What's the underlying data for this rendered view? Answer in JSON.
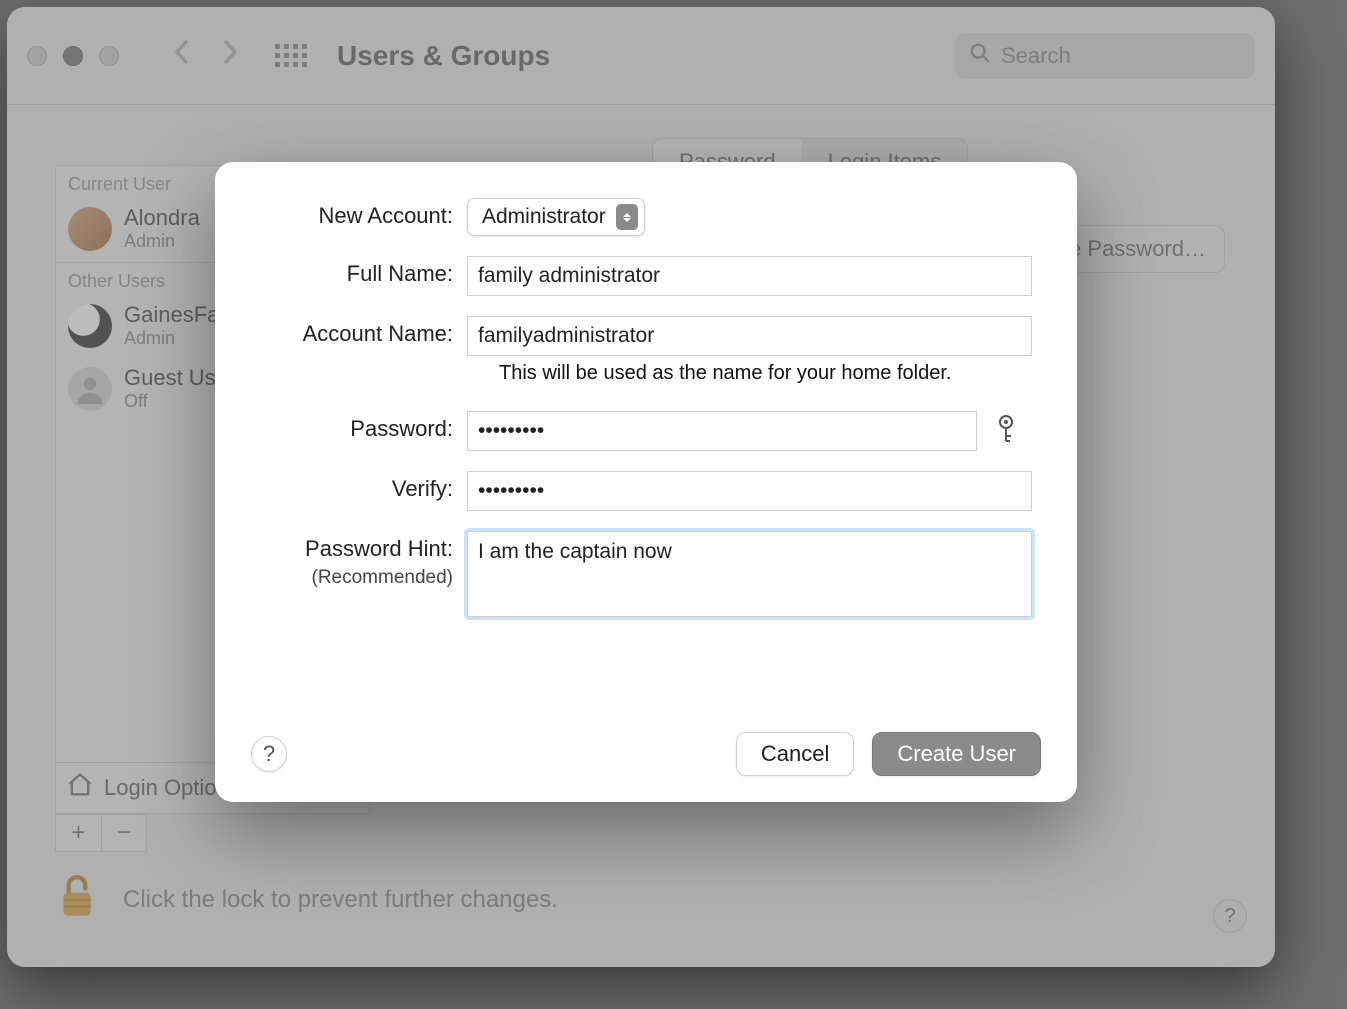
{
  "window": {
    "title": "Users & Groups",
    "search_placeholder": "Search"
  },
  "tabs": {
    "password": "Password",
    "login_items": "Login Items"
  },
  "change_password_button": "Change Password…",
  "sidebar": {
    "current_heading": "Current User",
    "other_heading": "Other Users",
    "users": [
      {
        "name": "Alondra",
        "sub": "Admin"
      },
      {
        "name": "GainesFamily",
        "sub": "Admin"
      },
      {
        "name": "Guest User",
        "sub": "Off"
      }
    ],
    "login_options": "Login Options"
  },
  "lock_text": "Click the lock to prevent further changes.",
  "sheet": {
    "labels": {
      "new_account": "New Account:",
      "full_name": "Full Name:",
      "account_name": "Account Name:",
      "password": "Password:",
      "verify": "Verify:",
      "hint": "Password Hint:",
      "hint_sub": "(Recommended)"
    },
    "values": {
      "account_type": "Administrator",
      "full_name": "family administrator",
      "account_name": "familyadministrator",
      "password": "•••••••••",
      "verify": "•••••••••",
      "hint": "I am the captain now"
    },
    "helper_account_name": "This will be used as the name for your home folder.",
    "buttons": {
      "cancel": "Cancel",
      "create": "Create User"
    }
  }
}
